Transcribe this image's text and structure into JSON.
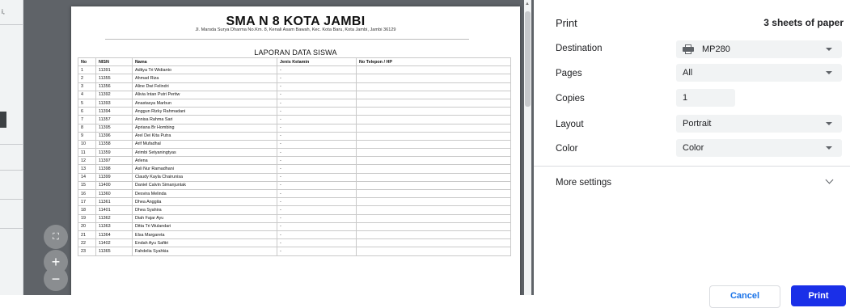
{
  "preview": {
    "school_name": "SMA N 8 KOTA JAMBI",
    "address": "Jl. Marsda Surya Dharma No.Km. 8, Kenali Asam Bawah, Kec. Kota Baru, Kota Jambi, Jambi 36129",
    "report_title": "LAPORAN DATA SISWA",
    "columns": [
      "No",
      "NISN",
      "Nama",
      "Jenis Kelamin",
      "No Telepon / HP"
    ],
    "rows": [
      [
        "1",
        "11391",
        "Aditya Tri Widianto",
        "-",
        ""
      ],
      [
        "2",
        "11355",
        "Ahmad Riza",
        "-",
        ""
      ],
      [
        "3",
        "11356",
        "Aline Dwi Felindri",
        "-",
        ""
      ],
      [
        "4",
        "11392",
        "Alivia Intan Putri Pertiw",
        "-",
        ""
      ],
      [
        "5",
        "11393",
        "Anastasya Marbun",
        "-",
        ""
      ],
      [
        "6",
        "11394",
        "Anggun Rizky Rahmadani",
        "-",
        ""
      ],
      [
        "7",
        "11357",
        "Annisa Rahma Sari",
        "-",
        ""
      ],
      [
        "8",
        "11395",
        "Apriana Br Hombing",
        "-",
        ""
      ],
      [
        "9",
        "11396",
        "Arel Dei Kita Putra",
        "-",
        ""
      ],
      [
        "10",
        "11358",
        "Arif Mufadhal",
        "-",
        ""
      ],
      [
        "11",
        "11359",
        "Arimbi Setyaningtyas",
        "-",
        ""
      ],
      [
        "12",
        "11397",
        "Arlena",
        "-",
        ""
      ],
      [
        "13",
        "11398",
        "Asli Nur Ramadhani",
        "-",
        ""
      ],
      [
        "14",
        "11399",
        "Claudy Kayla Chairunisa",
        "-",
        ""
      ],
      [
        "15",
        "11400",
        "Daniel Calvin Simanjuntak",
        "-",
        ""
      ],
      [
        "16",
        "11360",
        "Desvira Melinda",
        "-",
        ""
      ],
      [
        "17",
        "11361",
        "Dhea Anggita",
        "-",
        ""
      ],
      [
        "18",
        "11401",
        "Dhea Syahira",
        "-",
        ""
      ],
      [
        "19",
        "11362",
        "Diah Fajar Ayu",
        "-",
        ""
      ],
      [
        "20",
        "11363",
        "Ditta Tri Wulandari",
        "-",
        ""
      ],
      [
        "21",
        "11364",
        "Elsa Margareta",
        "-",
        ""
      ],
      [
        "22",
        "11402",
        "Endah Ayu Safitri",
        "-",
        ""
      ],
      [
        "23",
        "11365",
        "Fahdelia Syahkia",
        "-",
        ""
      ]
    ]
  },
  "zoom": {
    "fit_icon": "fit-to-page-icon",
    "zoom_in_label": "+",
    "zoom_out_label": "−"
  },
  "panel": {
    "title": "Print",
    "sheet_count": "3 sheets of paper",
    "destination_label": "Destination",
    "destination_value": "MP280",
    "pages_label": "Pages",
    "pages_value": "All",
    "copies_label": "Copies",
    "copies_value": "1",
    "layout_label": "Layout",
    "layout_value": "Portrait",
    "color_label": "Color",
    "color_value": "Color",
    "more_settings_label": "More settings",
    "cancel_label": "Cancel",
    "print_label": "Print",
    "accent_color": "#1a73e8"
  },
  "left_strip": {
    "mark": "i,"
  }
}
